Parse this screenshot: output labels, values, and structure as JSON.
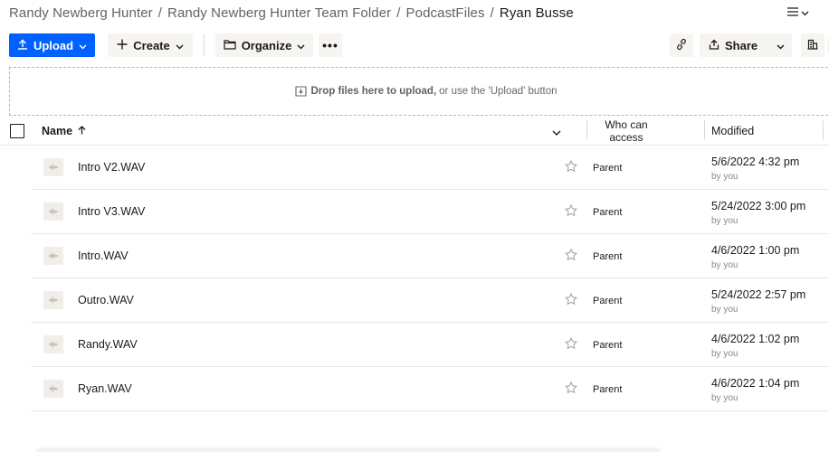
{
  "breadcrumb": {
    "items": [
      "Randy Newberg Hunter",
      "Randy Newberg Hunter Team Folder",
      "PodcastFiles"
    ],
    "separator": "/",
    "current": "Ryan Busse"
  },
  "toolbar": {
    "upload_label": "Upload",
    "create_label": "Create",
    "organize_label": "Organize",
    "more_label": "•••",
    "share_label": "Share"
  },
  "dropzone": {
    "bold_text": "Drop files here to upload,",
    "rest_text": "or use the 'Upload' button"
  },
  "table": {
    "headers": {
      "name": "Name",
      "access": "Who can access",
      "modified": "Modified"
    },
    "rows": [
      {
        "name": "Intro V2.WAV",
        "access": "Parent",
        "modified": "5/6/2022 4:32 pm",
        "by": "by you"
      },
      {
        "name": "Intro V3.WAV",
        "access": "Parent",
        "modified": "5/24/2022 3:00 pm",
        "by": "by you"
      },
      {
        "name": "Intro.WAV",
        "access": "Parent",
        "modified": "4/6/2022 1:00 pm",
        "by": "by you"
      },
      {
        "name": "Outro.WAV",
        "access": "Parent",
        "modified": "5/24/2022 2:57 pm",
        "by": "by you"
      },
      {
        "name": "Randy.WAV",
        "access": "Parent",
        "modified": "4/6/2022 1:02 pm",
        "by": "by you"
      },
      {
        "name": "Ryan.WAV",
        "access": "Parent",
        "modified": "4/6/2022 1:04 pm",
        "by": "by you"
      }
    ]
  },
  "colors": {
    "accent": "#0061fe",
    "button_bg": "#f7f5f2",
    "text": "#1e1919",
    "muted": "#636363"
  },
  "icons": {
    "file": "audio-file-icon",
    "star": "star-icon",
    "upload": "upload-icon",
    "create": "plus-icon",
    "organize": "folder-icon",
    "link": "link-icon",
    "share": "share-icon",
    "view": "list-view-icon"
  }
}
